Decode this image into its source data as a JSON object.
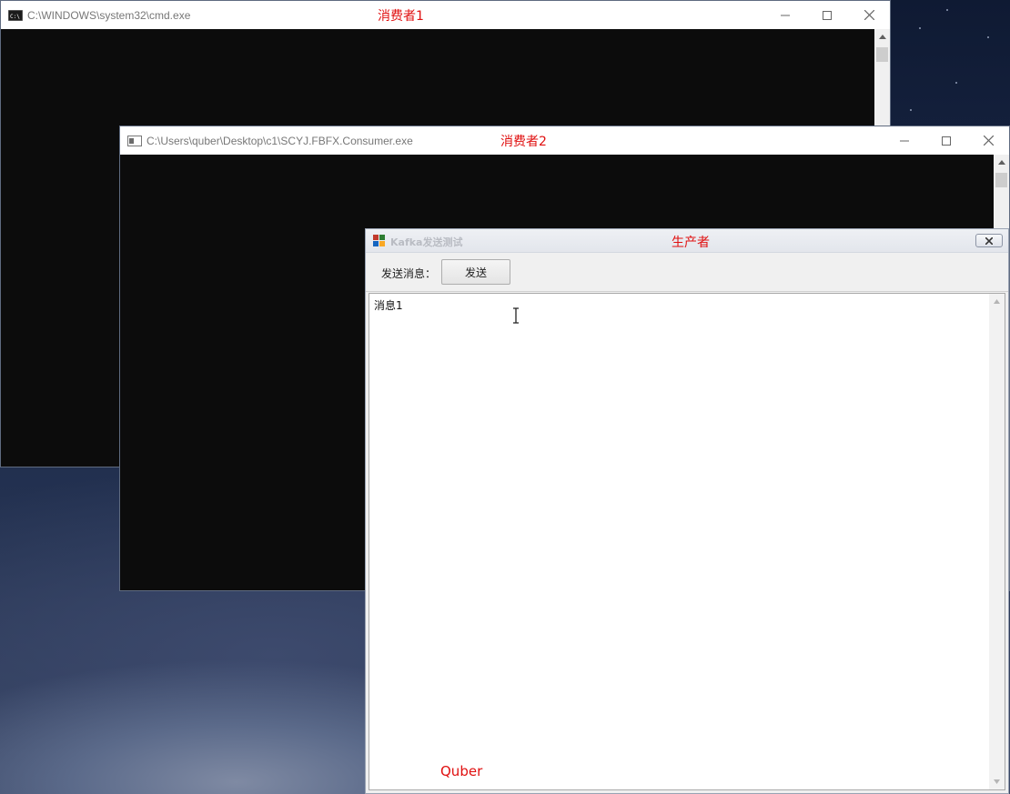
{
  "windows": {
    "consumer1": {
      "title": "C:\\WINDOWS\\system32\\cmd.exe",
      "annotation": "消费者1"
    },
    "consumer2": {
      "title": "C:\\Users\\quber\\Desktop\\c1\\SCYJ.FBFX.Consumer.exe",
      "annotation": "消费者2"
    },
    "producer": {
      "title": "Kafka发送测试",
      "annotation": "生产者",
      "send_label": "发送消息：",
      "send_button": "发送",
      "textarea_content": "消息1"
    }
  },
  "watermark": "Quber",
  "colors": {
    "annotation_red": "#e01010",
    "console_bg": "#0c0c0c",
    "titlebar_bg": "#ffffff"
  }
}
